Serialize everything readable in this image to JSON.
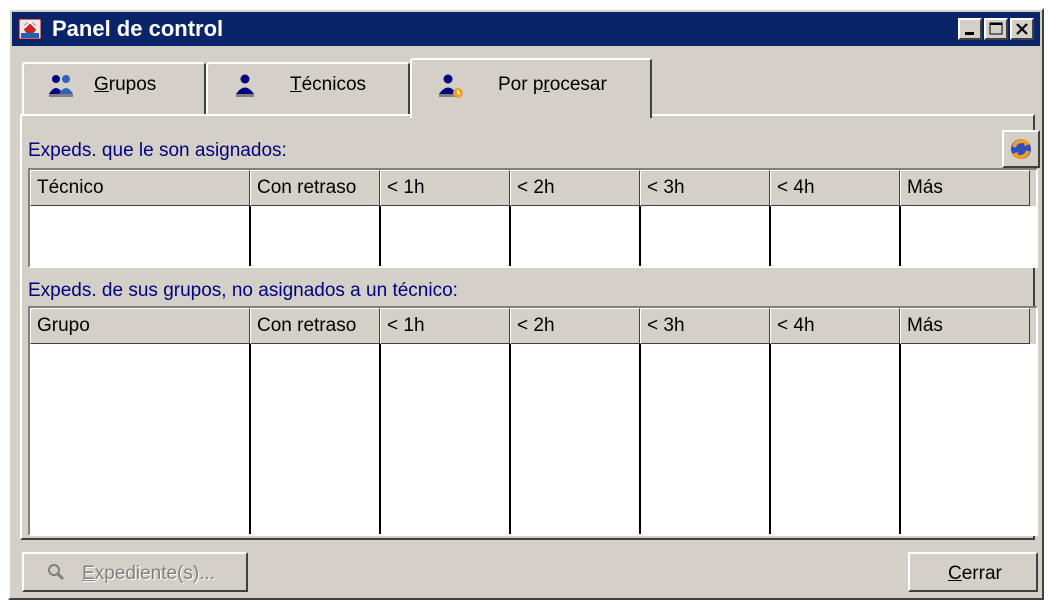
{
  "window": {
    "title": "Panel de control",
    "icon": "control-panel-icon",
    "accent": "#0a246a"
  },
  "tabs": [
    {
      "pre": "",
      "mnemonic": "G",
      "post": "rupos",
      "icon": "group-icon"
    },
    {
      "pre": "",
      "mnemonic": "T",
      "post": "écnicos",
      "icon": "technician-icon"
    },
    {
      "pre": "Por p",
      "mnemonic": "r",
      "post": "ocesar",
      "icon": "pending-technician-icon",
      "active": true
    }
  ],
  "assigned": {
    "label": "Expeds. que le son asignados:",
    "columns": [
      "Técnico",
      "Con retraso",
      "< 1h",
      "< 2h",
      "< 3h",
      "< 4h",
      "Más"
    ]
  },
  "groups": {
    "label_pre": "Expeds. de sus ",
    "label_mnemonic": "g",
    "label_post": "rupos, no asignados a un técnico:",
    "columns": [
      "Grupo",
      "Con retraso",
      "< 1h",
      "< 2h",
      "< 3h",
      "< 4h",
      "Más"
    ]
  },
  "buttons": {
    "expediente_mnemonic": "E",
    "expediente_post": "xpediente(s)...",
    "cerrar_mnemonic": "C",
    "cerrar_post": "errar"
  },
  "icons": {
    "refresh": "refresh-icon",
    "search": "magnifier-icon"
  }
}
